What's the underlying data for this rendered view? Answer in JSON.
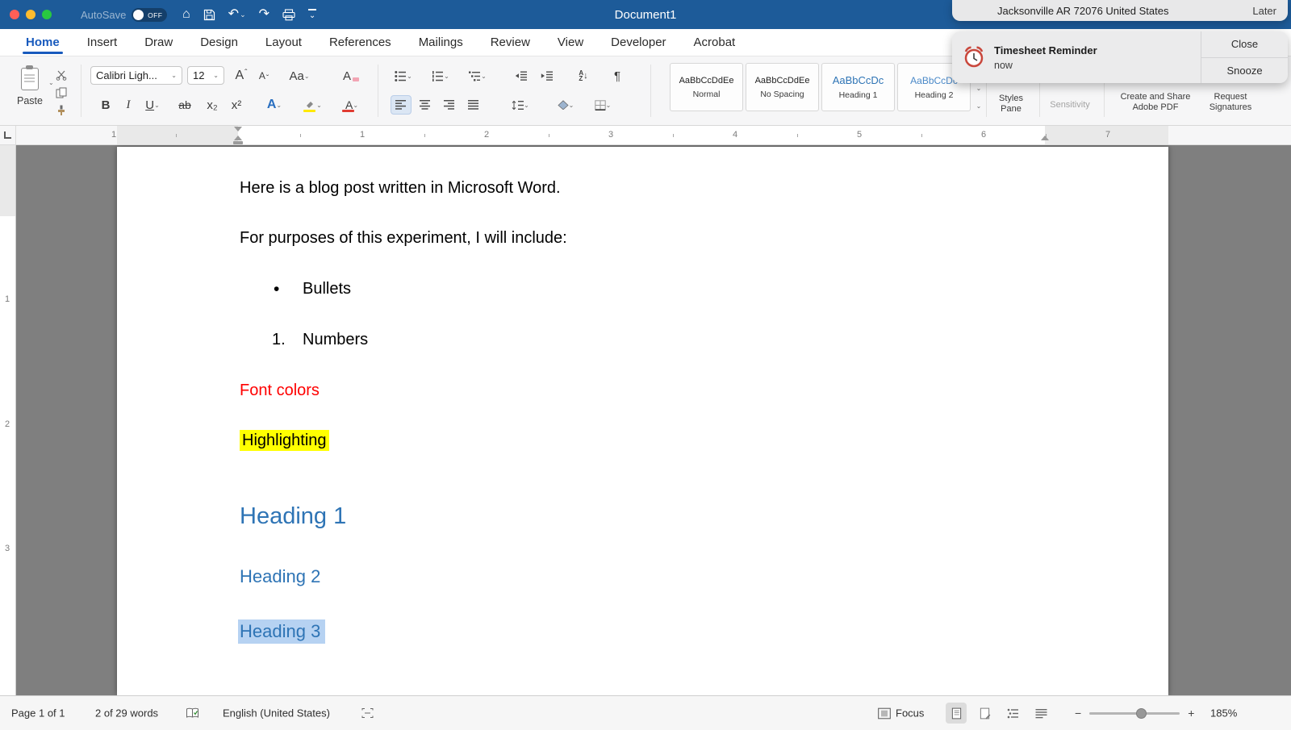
{
  "window": {
    "title": "Document1",
    "autosave_label": "AutoSave",
    "autosave_state": "OFF"
  },
  "notifications": {
    "previous": {
      "text": "Jacksonville AR 72076 United States",
      "action": "Later"
    },
    "current": {
      "title": "Timesheet Reminder",
      "time": "now",
      "close": "Close",
      "snooze": "Snooze"
    }
  },
  "tabs": [
    {
      "label": "Home",
      "active": true
    },
    {
      "label": "Insert"
    },
    {
      "label": "Draw"
    },
    {
      "label": "Design"
    },
    {
      "label": "Layout"
    },
    {
      "label": "References"
    },
    {
      "label": "Mailings"
    },
    {
      "label": "Review"
    },
    {
      "label": "View"
    },
    {
      "label": "Developer"
    },
    {
      "label": "Acrobat"
    }
  ],
  "ribbon": {
    "paste_label": "Paste",
    "font_name": "Calibri Ligh...",
    "font_size": "12",
    "style_gallery": [
      {
        "preview": "AaBbCcDdEe",
        "name": "Normal",
        "color": "#222222",
        "size": 11
      },
      {
        "preview": "AaBbCcDdEe",
        "name": "No Spacing",
        "color": "#222222",
        "size": 11
      },
      {
        "preview": "AaBbCcDc",
        "name": "Heading 1",
        "color": "#2e74b5",
        "size": 13
      },
      {
        "preview": "AaBbCcDc",
        "name": "Heading 2",
        "color": "#4a89c8",
        "size": 12
      }
    ],
    "styles_pane_l1": "Styles",
    "styles_pane_l2": "Pane",
    "sensitivity_label": "Sensitivity",
    "adobe_l1": "Create and Share",
    "adobe_l2": "Adobe PDF",
    "sig_l1": "Request",
    "sig_l2": "Signatures"
  },
  "icons": {
    "chevron_down": "⌄",
    "home": "⌂",
    "undo": "↶",
    "redo": "↷",
    "bold": "B",
    "italic": "I",
    "underline": "U",
    "strikethrough": "ab",
    "subscript": "x₂",
    "superscript": "x²",
    "letter_a": "A",
    "change_case": "Aa",
    "caret_up": "ˆ",
    "caret_down": "ˇ",
    "pilcrow": "¶",
    "sort_a": "A",
    "sort_z": "Z",
    "arrow_down": "↓"
  },
  "ruler": {
    "h_numbers": [
      "1",
      "2",
      "3",
      "4",
      "5",
      "6",
      "7"
    ],
    "h_margin_number": "1",
    "v_numbers": [
      "1",
      "2",
      "3"
    ]
  },
  "document": {
    "paragraphs": [
      {
        "style": "body",
        "text": "Here is a blog post written in Microsoft Word."
      },
      {
        "style": "body",
        "text": "For purposes of this experiment, I will include:"
      },
      {
        "style": "bullet",
        "marker": "•",
        "text": "Bullets"
      },
      {
        "style": "numbered",
        "marker": "1.",
        "text": "Numbers"
      },
      {
        "style": "fontcolor",
        "text": "Font colors"
      },
      {
        "style": "highlight",
        "text": "Highlighting"
      },
      {
        "style": "heading1",
        "text": "Heading 1"
      },
      {
        "style": "heading2",
        "text": "Heading 2"
      },
      {
        "style": "heading3",
        "text": "Heading 3",
        "selected": true
      }
    ]
  },
  "statusbar": {
    "page": "Page 1 of 1",
    "words": "2 of 29 words",
    "language": "English (United States)",
    "focus_label": "Focus",
    "zoom_out": "−",
    "zoom_in": "+",
    "zoom_level": "185%"
  },
  "colors": {
    "titlebar": "#1d5b99",
    "accent_blue": "#185abd",
    "heading_blue": "#2e74b5",
    "red_text": "#ff0000",
    "highlight_yellow": "#ffff00",
    "selection_blue": "#b6d2f2",
    "page_background_gray": "#7f7f7f"
  }
}
